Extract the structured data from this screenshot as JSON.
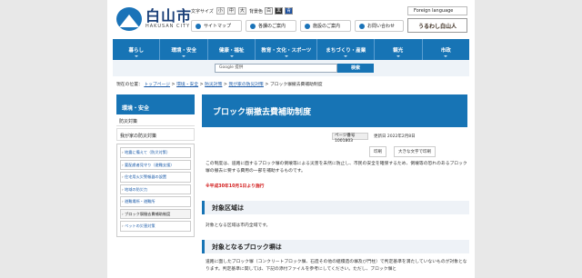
{
  "header": {
    "logo_title": "白山市",
    "logo_sub": "HAKUSAN CITY",
    "font_size_label": "文字サイズ",
    "font_sizes": [
      "小",
      "中",
      "大"
    ],
    "bg_color_label": "背景色",
    "bg_colors": [
      "白",
      "黒",
      "青"
    ],
    "util_links": [
      "サイトマップ",
      "各課のご案内",
      "施設のご案内",
      "お問い合わせ"
    ],
    "foreign_language": "Foreign language",
    "banner": "うるわし白山人"
  },
  "nav": [
    "暮らし",
    "環境・安全",
    "健康・福祉",
    "教育・文化・スポーツ",
    "まちづくり・産業",
    "観光",
    "市政"
  ],
  "search": {
    "placeholder": "Google 提供",
    "button": "検索"
  },
  "breadcrumb": {
    "prefix": "現在の位置：",
    "items": [
      "トップページ",
      "環境・安全",
      "防災対策",
      "我が家の防災対策",
      "ブロック塀撤去費補助制度"
    ]
  },
  "sidebar": {
    "heading": "環境・安全",
    "category1": "防災対策",
    "category2": "我が家の防災対策",
    "items": [
      "地震に備えて（防災対策）",
      "要配慮者見守り（避難支援）",
      "住宅用火災警報器の設置",
      "地域の防災力",
      "避難場所・避難所",
      "ブロック塀撤去費補助制度",
      "ペットの災害対策"
    ]
  },
  "main": {
    "title": "ブロック塀撤去費補助制度",
    "page_id": "ページ番号1001803",
    "updated": "更新日 2022年2月8日",
    "print": "印刷",
    "big_print": "大きな文字で印刷",
    "intro": "この制度は、道路に面するブロック塀の倒壊等による災害を未然に防止し、市民の安全を確保するため、倒壊等の恐れのあるブロック塀の撤去に要する費用の一部を補助するものです。",
    "note": "※平成30年10月1日より施行",
    "section1_title": "対象区域は",
    "section1_text": "対象となる区域は市内全域です。",
    "section2_title": "対象となるブロック塀は",
    "section2_text": "道路に面したブロック塀（コンクリートブロック塀、石造その他の組積造の塀及び門柱）で判定基準を満たしていないものが対象となります。判定基準に関しては、下記の添付ファイルを参考にしてください。ただし、ブロック塀と"
  }
}
